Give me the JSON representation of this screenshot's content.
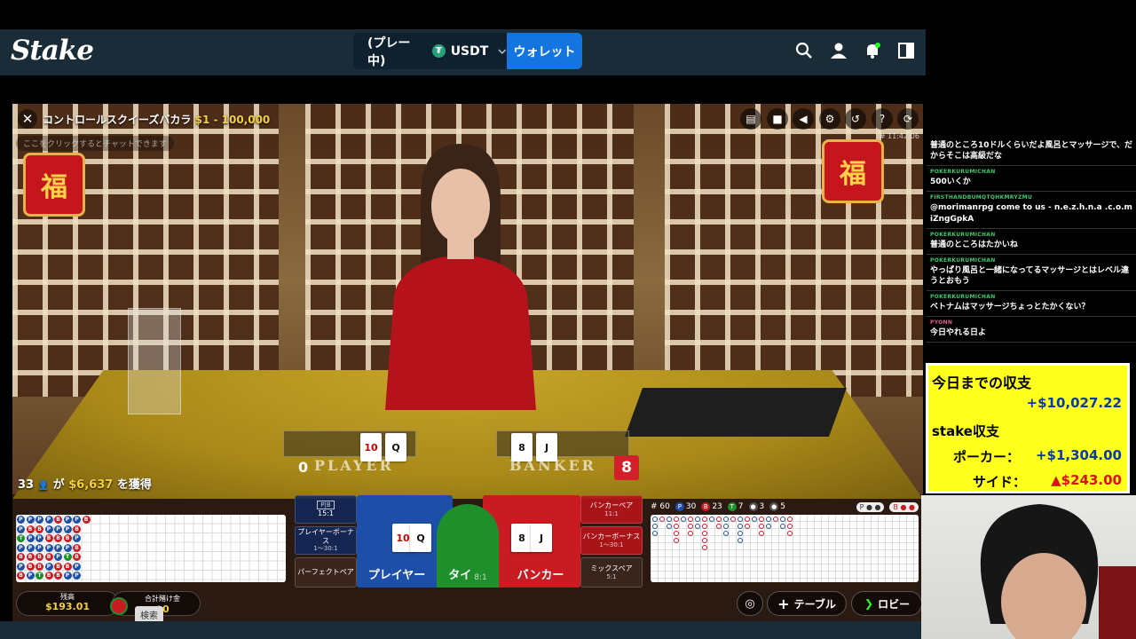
{
  "header": {
    "logo": "Stake",
    "balance_mode": "(プレー中)",
    "currency": "USDT",
    "currency_symbol": "₮",
    "wallet_label": "ウォレット"
  },
  "game": {
    "title": "コントロールスクイーズバカラ",
    "limits": "$1 - 100,000",
    "chat_hint": "ここをクリックするとチャットできます",
    "game_id": "# 11:42:06",
    "winners_count": "33",
    "winners_mid": " が ",
    "winners_amount": "$6,637",
    "winners_suffix": " を獲得",
    "player_label": "PLAYER",
    "banker_label": "BANKER",
    "player_score": "0",
    "banker_score": "8",
    "player_cards": [
      "10",
      "Q"
    ],
    "banker_cards": [
      "8",
      "J"
    ]
  },
  "bets": {
    "top_left_odds": "15:1",
    "player_bonus": "プレイヤーボーナス",
    "player_bonus_odds": "1〜30:1",
    "perfect_pair": "パーフェクトペア",
    "player": "プレイヤー",
    "tie": "タイ",
    "tie_odds": "8:1",
    "banker": "バンカー",
    "banker_pair": "バンカーペア",
    "banker_pair_odds": "11:1",
    "banker_bonus": "バンカーボーナス",
    "banker_bonus_odds": "1〜30:1",
    "mix_pair": "ミックスペア",
    "mix_pair_odds": "5:1"
  },
  "road_stats": {
    "total": "# 60",
    "player": "30",
    "banker": "23",
    "tie": "7",
    "player_pair": "3",
    "banker_pair": "5"
  },
  "footer": {
    "balance_label": "残高",
    "balance_value": "$193.01",
    "total_bet_label": "合計賭け金",
    "total_bet_value": "$0",
    "search_tip": "検索",
    "table_label": "テーブル",
    "lobby_label": "ロビー"
  },
  "chat": [
    {
      "user": "",
      "text": "普通のところ10ドルくらいだよ風呂とマッサージで、だからそこは高級だな"
    },
    {
      "user": "POKERKURUMICHAN",
      "text": "500いくか"
    },
    {
      "user": "FIRSTHANDBUMQTQHKMRYZMU",
      "text": "@morimanrpg come to us - n.e.z.h.n.a .c.o.m iZngGpkA"
    },
    {
      "user": "POKERKURUMICHAN",
      "text": "普通のところはたかいね"
    },
    {
      "user": "POKERKURUMICHAN",
      "text": "やっぱり風呂と一緒になってるマッサージとはレベル違うとおもう"
    },
    {
      "user": "POKERKURUMICHAN",
      "text": "ベトナムはマッサージちょっとたかくない？"
    },
    {
      "user": "PYONN",
      "text": "今日やれる日よ",
      "pink": true
    }
  ],
  "earnings": {
    "title": "今日までの収支",
    "total": "+$10,027.22",
    "stake_label": "stake収支",
    "poker_label": "ポーカー：",
    "poker_value": "+$1,304.00",
    "side_label": "サイド：",
    "side_value": "▲$243.00"
  },
  "colors": {
    "stake_bg": "#1a2c38",
    "wallet_blue": "#1475e1",
    "player_blue": "#1d4fa8",
    "banker_red": "#c81b22",
    "tie_green": "#1f8f2c",
    "earnings_yellow": "#ffff1e"
  }
}
